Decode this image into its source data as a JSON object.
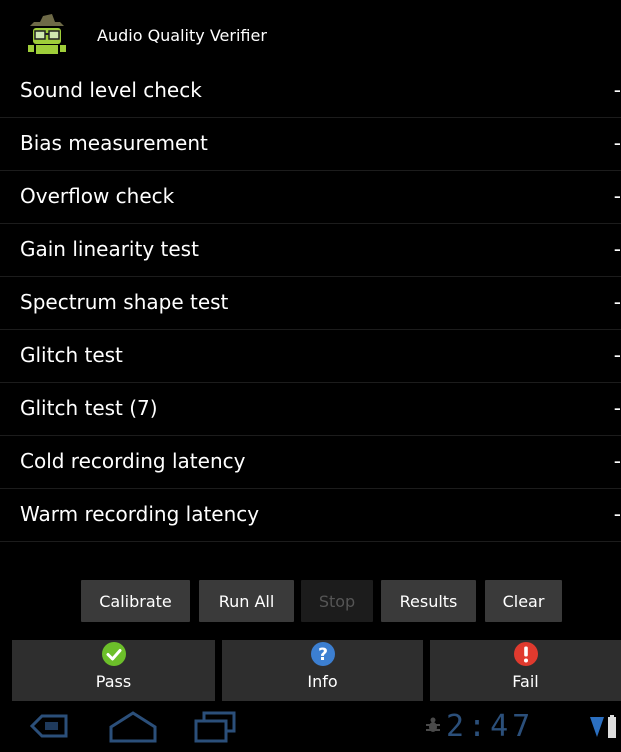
{
  "app": {
    "title": "Audio Quality Verifier",
    "icon": "robot-glasses-icon"
  },
  "tests": [
    {
      "label": "Sound level check",
      "status": "-"
    },
    {
      "label": "Bias measurement",
      "status": "-"
    },
    {
      "label": "Overflow check",
      "status": "-"
    },
    {
      "label": "Gain linearity test",
      "status": "-"
    },
    {
      "label": "Spectrum shape test",
      "status": "-"
    },
    {
      "label": "Glitch test",
      "status": "-"
    },
    {
      "label": "Glitch test (7)",
      "status": "-"
    },
    {
      "label": "Cold recording latency",
      "status": "-"
    },
    {
      "label": "Warm recording latency",
      "status": "-"
    }
  ],
  "actions": {
    "calibrate": "Calibrate",
    "run_all": "Run All",
    "stop": "Stop",
    "results": "Results",
    "clear": "Clear"
  },
  "pass_fail": {
    "pass": "Pass",
    "info": "Info",
    "fail": "Fail"
  },
  "status_bar": {
    "time": "2:47",
    "icons": [
      "back-icon",
      "home-icon",
      "recent-apps-icon",
      "debug-icon",
      "signal-icon",
      "battery-icon"
    ]
  },
  "colors": {
    "pass": "#6cbf2a",
    "info": "#3c7fd1",
    "fail": "#e03a2e",
    "clock": "#2b4f7a"
  }
}
